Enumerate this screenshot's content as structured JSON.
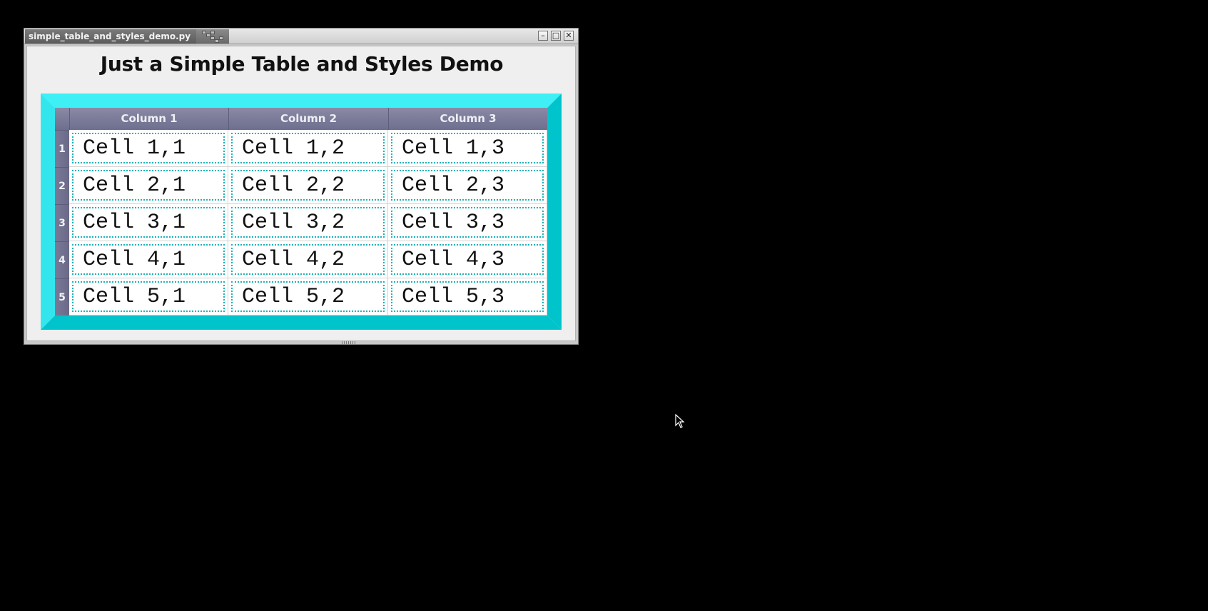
{
  "window": {
    "title": "simple_table_and_styles_demo.py",
    "controls": {
      "minimize_glyph": "–",
      "maximize_glyph": "□",
      "close_glyph": "✕"
    }
  },
  "heading": "Just a Simple Table and Styles Demo",
  "table": {
    "columns": [
      "Column 1",
      "Column 2",
      "Column 3"
    ],
    "row_labels": [
      "1",
      "2",
      "3",
      "4",
      "5"
    ],
    "rows": [
      [
        "Cell 1,1",
        "Cell 1,2",
        "Cell 1,3"
      ],
      [
        "Cell 2,1",
        "Cell 2,2",
        "Cell 2,3"
      ],
      [
        "Cell 3,1",
        "Cell 3,2",
        "Cell 3,3"
      ],
      [
        "Cell 4,1",
        "Cell 4,2",
        "Cell 4,3"
      ],
      [
        "Cell 5,1",
        "Cell 5,2",
        "Cell 5,3"
      ]
    ]
  },
  "colors": {
    "desktop": "#000000",
    "frame_light": "#3ef0f5",
    "frame_dark": "#00c4cc",
    "header_bg": "#7c7c9a",
    "cell_dot_border": "#19b3b8"
  },
  "icons": {
    "cursor": "mouse-pointer-icon",
    "grip": "window-grip-icon"
  }
}
